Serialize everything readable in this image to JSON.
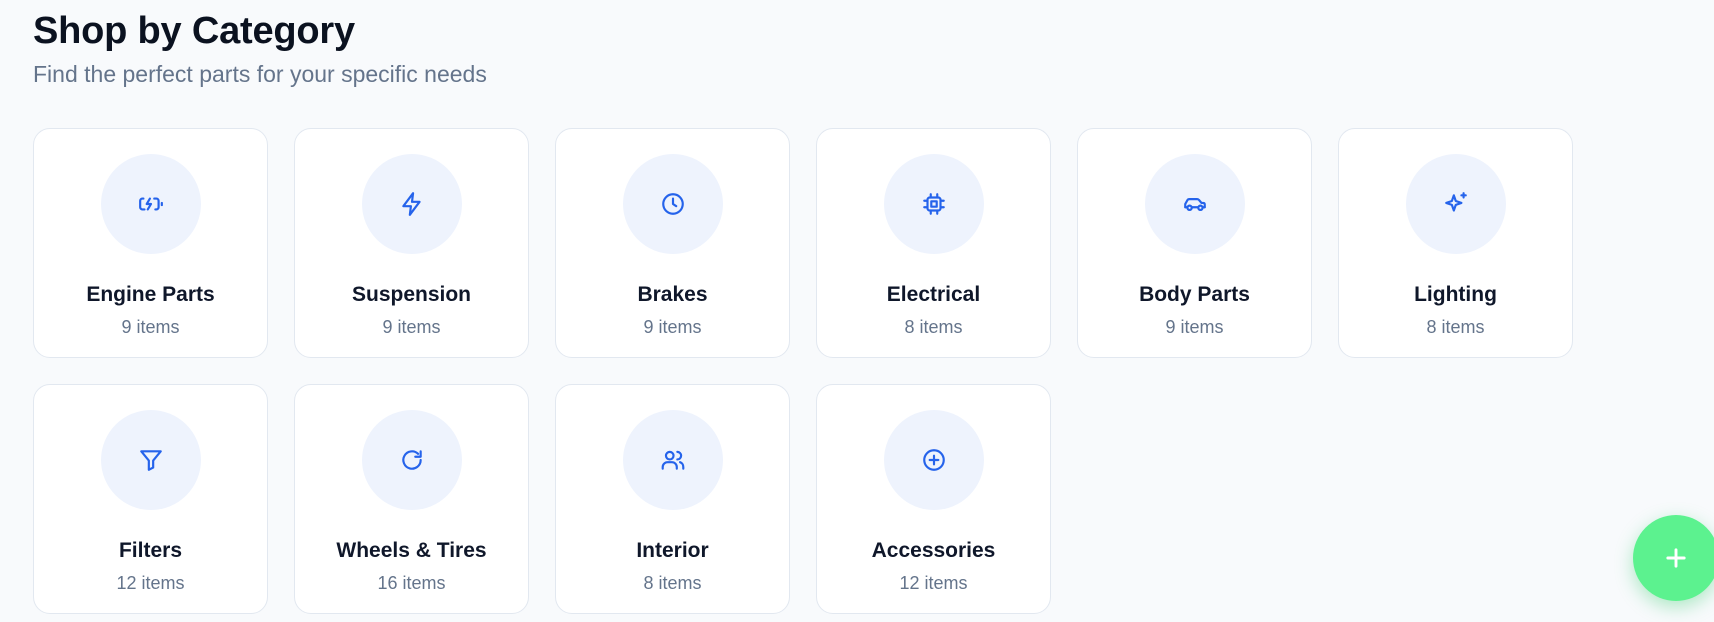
{
  "header": {
    "title": "Shop by Category",
    "subtitle": "Find the perfect parts for your specific needs"
  },
  "categories": [
    {
      "name": "Engine Parts",
      "count": "9 items",
      "icon": "battery-charging-icon"
    },
    {
      "name": "Suspension",
      "count": "9 items",
      "icon": "zap-icon"
    },
    {
      "name": "Brakes",
      "count": "9 items",
      "icon": "clock-icon"
    },
    {
      "name": "Electrical",
      "count": "8 items",
      "icon": "cpu-icon"
    },
    {
      "name": "Body Parts",
      "count": "9 items",
      "icon": "car-icon"
    },
    {
      "name": "Lighting",
      "count": "8 items",
      "icon": "sparkles-icon"
    },
    {
      "name": "Filters",
      "count": "12 items",
      "icon": "filter-icon"
    },
    {
      "name": "Wheels & Tires",
      "count": "16 items",
      "icon": "refresh-icon"
    },
    {
      "name": "Interior",
      "count": "8 items",
      "icon": "users-icon"
    },
    {
      "name": "Accessories",
      "count": "12 items",
      "icon": "plus-circle-icon"
    }
  ],
  "fab": {
    "icon": "plus-icon"
  },
  "colors": {
    "accent": "#2563eb",
    "icon_bg": "#eef3fd",
    "fab": "#5cf28f",
    "muted_text": "#64748b",
    "page_bg": "#f8fafc"
  }
}
